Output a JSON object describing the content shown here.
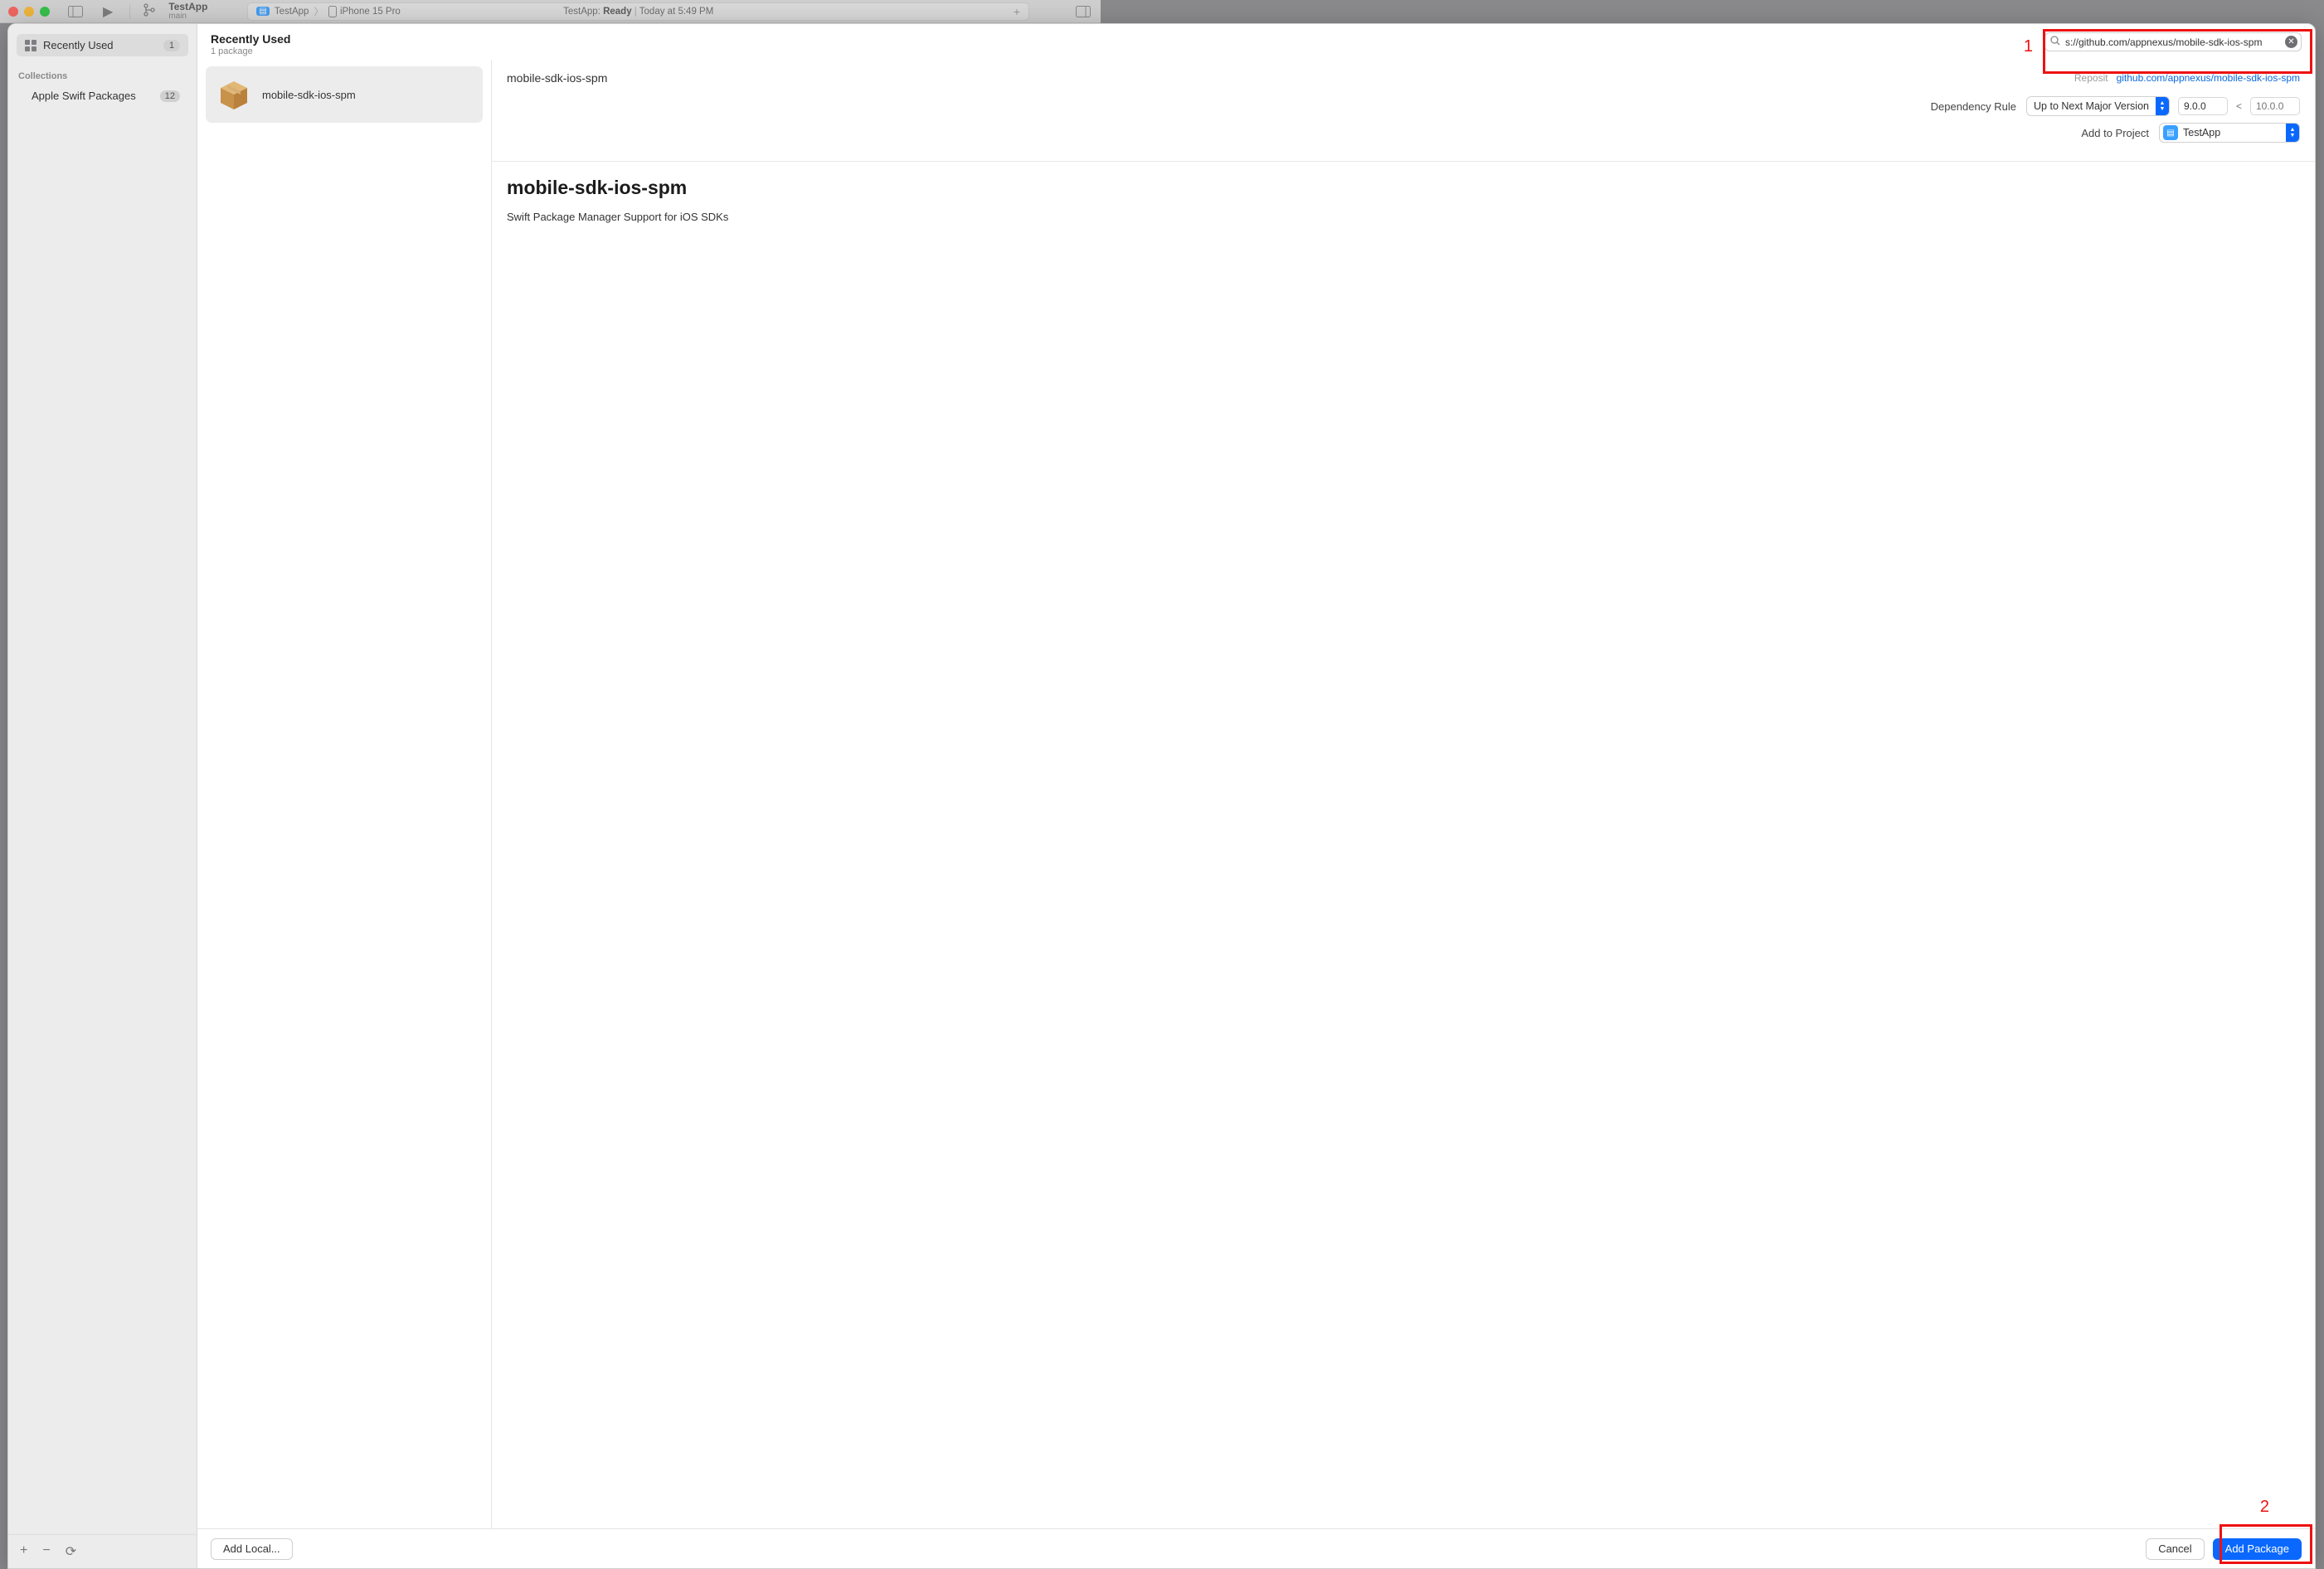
{
  "xcode": {
    "scheme_name": "TestApp",
    "scheme_branch": "main",
    "build_target": "TestApp",
    "device": "iPhone 15 Pro",
    "status_app": "TestApp:",
    "status_state": "Ready",
    "status_time": "Today at 5:49 PM",
    "add_tab_glyph": "+",
    "panel_toggle_glyph": "▢"
  },
  "sidebar": {
    "items": [
      {
        "label": "Recently Used",
        "count": "1"
      }
    ],
    "collections_label": "Collections",
    "collections": [
      {
        "label": "Apple Swift Packages",
        "count": "12"
      }
    ],
    "bottom": {
      "add": "+",
      "remove": "−",
      "reload": "⟳"
    }
  },
  "header": {
    "title": "Recently Used",
    "subtitle": "1 package",
    "search_value": "s://github.com/appnexus/mobile-sdk-ios-spm",
    "clear_glyph": "✕"
  },
  "packages": [
    {
      "name": "mobile-sdk-ios-spm"
    }
  ],
  "detail": {
    "title_small": "mobile-sdk-ios-spm",
    "repo_label": "Reposit",
    "repo_url_text": "github.com/appnexus/mobile-sdk-ios-spm",
    "dependency_rule_label": "Dependency Rule",
    "dependency_rule_value": "Up to Next Major Version",
    "version_from": "9.0.0",
    "lt": "<",
    "version_to_placeholder": "10.0.0",
    "add_to_project_label": "Add to Project",
    "project_name": "TestApp",
    "desc_title": "mobile-sdk-ios-spm",
    "desc_body": "Swift Package Manager Support for iOS SDKs"
  },
  "footer": {
    "add_local": "Add Local...",
    "cancel": "Cancel",
    "add_package": "Add Package"
  },
  "annotations": {
    "one": "1",
    "two": "2"
  }
}
